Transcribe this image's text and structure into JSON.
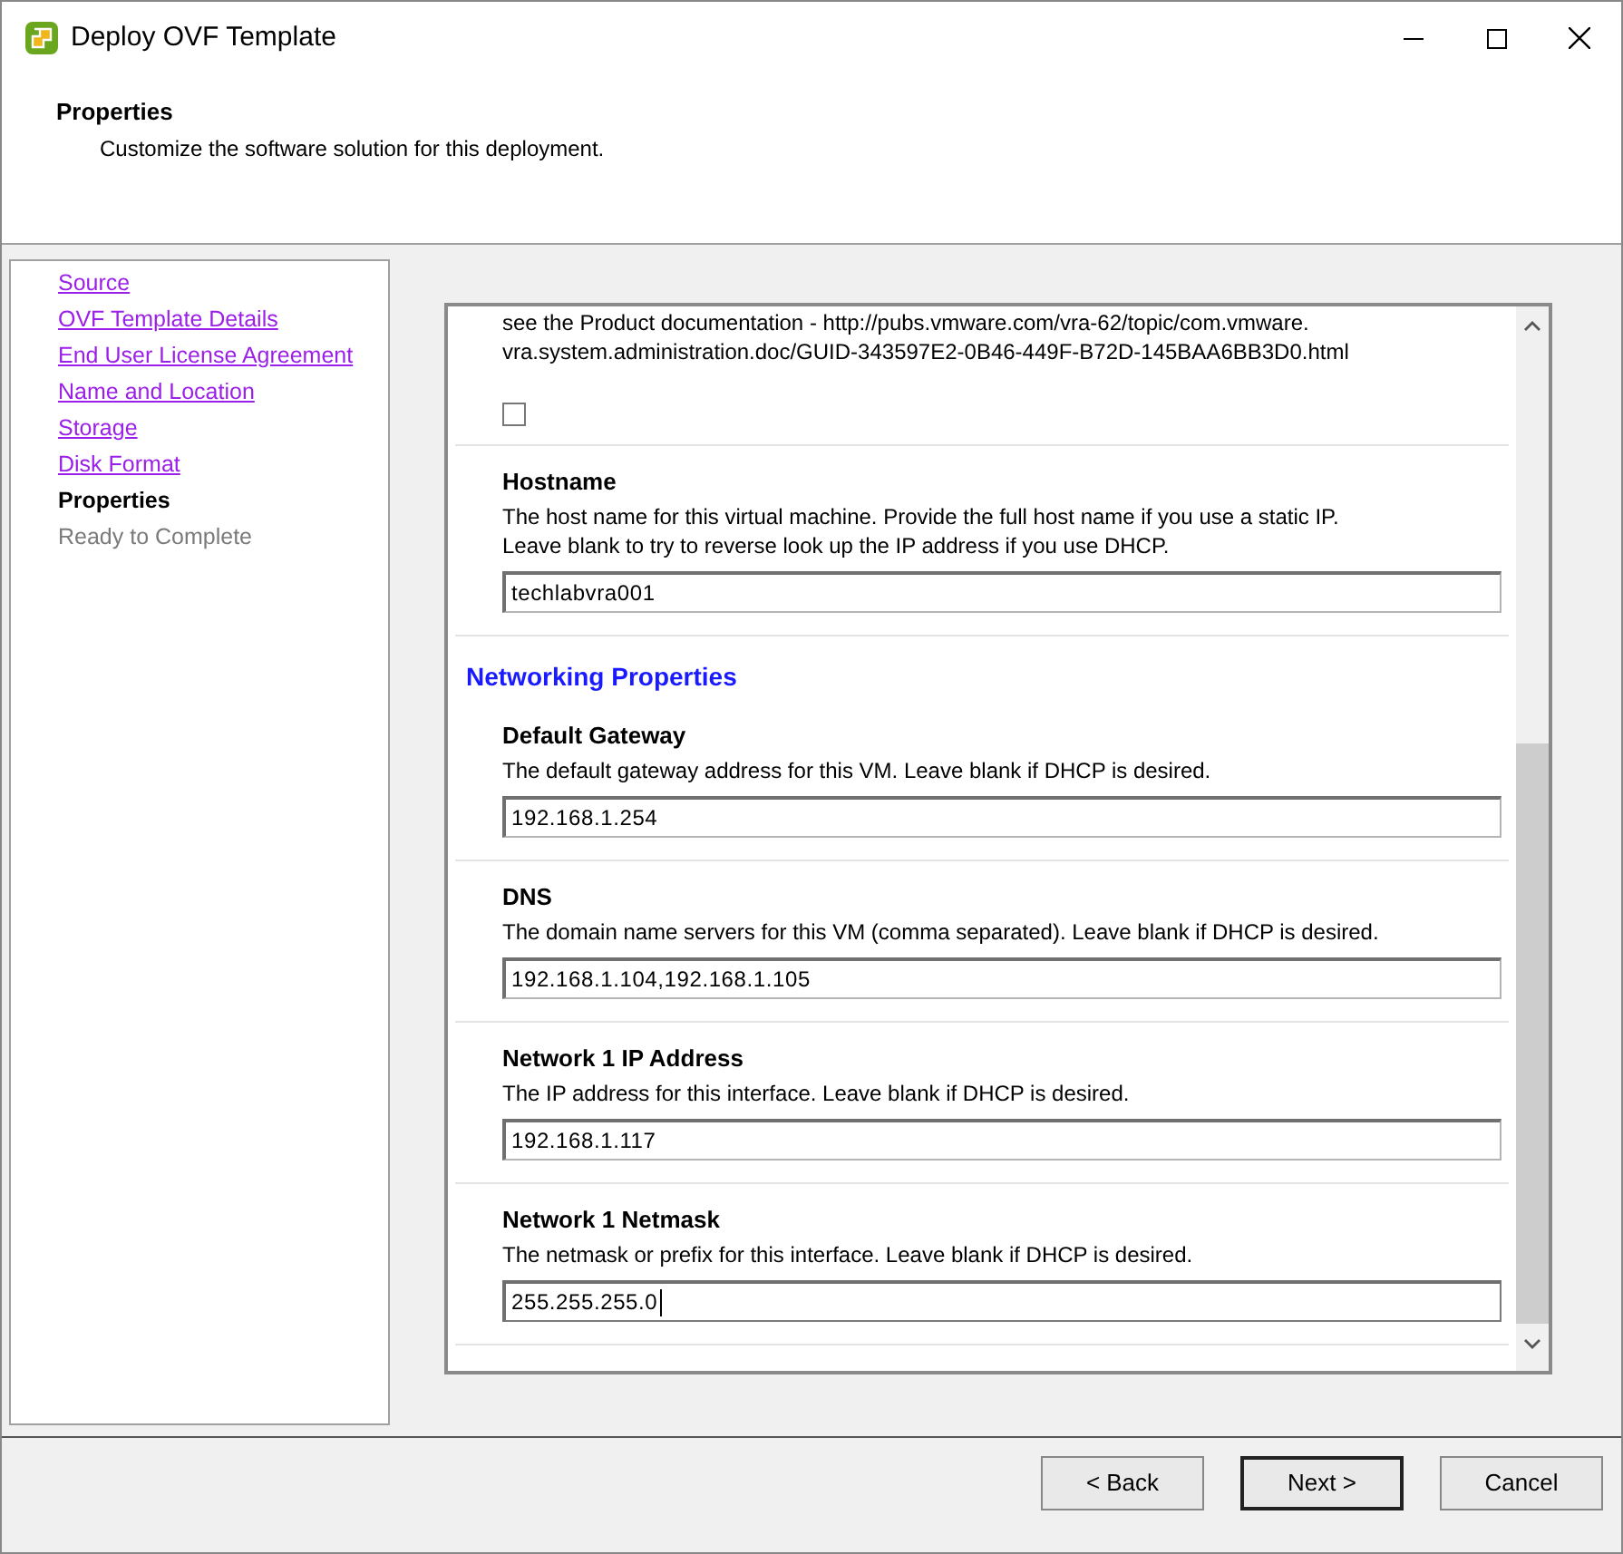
{
  "window": {
    "title": "Deploy OVF Template"
  },
  "header": {
    "title": "Properties",
    "subtitle": "Customize the software solution for this deployment."
  },
  "steps": [
    {
      "label": "Source",
      "kind": "link"
    },
    {
      "label": "OVF Template Details",
      "kind": "link"
    },
    {
      "label": "End User License Agreement",
      "kind": "link"
    },
    {
      "label": "Name and Location",
      "kind": "link"
    },
    {
      "label": "Storage",
      "kind": "link"
    },
    {
      "label": "Disk Format",
      "kind": "link"
    },
    {
      "label": "Properties",
      "kind": "current"
    },
    {
      "label": "Ready to Complete",
      "kind": "pending"
    }
  ],
  "properties": [
    {
      "kind": "checkbox",
      "description": "see the Product documentation - http://pubs.vmware.com/vra-62/topic/com.vmware.\nvra.system.administration.doc/GUID-343597E2-0B46-449F-B72D-145BAA6BB3D0.html",
      "checked": false
    },
    {
      "kind": "field",
      "label": "Hostname",
      "description": "The host name for this virtual machine. Provide the full host name if you use a static IP.\nLeave blank to try to reverse look up the IP address if you use DHCP.",
      "value": "techlabvra001",
      "focused": false
    },
    {
      "kind": "heading",
      "label": "Networking Properties"
    },
    {
      "kind": "field",
      "label": "Default Gateway",
      "description": "The default gateway address for this VM. Leave blank if DHCP is desired.",
      "value": "192.168.1.254",
      "focused": false
    },
    {
      "kind": "field",
      "label": "DNS",
      "description": "The domain name servers for this VM (comma separated). Leave blank if DHCP is desired.",
      "value": "192.168.1.104,192.168.1.105",
      "focused": false
    },
    {
      "kind": "field",
      "label": "Network 1 IP Address",
      "description": "The IP address for this interface. Leave blank if DHCP is desired.",
      "value": "192.168.1.117",
      "focused": false
    },
    {
      "kind": "field",
      "label": "Network 1 Netmask",
      "description": "The netmask or prefix for this interface. Leave blank if DHCP is desired.",
      "value": "255.255.255.0",
      "focused": true
    }
  ],
  "buttons": [
    {
      "label": "< Back",
      "default": false
    },
    {
      "label": "Next >",
      "default": true
    },
    {
      "label": "Cancel",
      "default": false
    }
  ]
}
